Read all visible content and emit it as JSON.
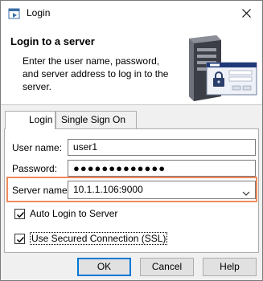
{
  "window": {
    "title": "Login"
  },
  "header": {
    "title": "Login to a server",
    "description": "Enter the user name, password, and server address to log in to the server."
  },
  "tabs": [
    {
      "label": "Login",
      "active": true
    },
    {
      "label": "Single Sign On",
      "active": false
    }
  ],
  "form": {
    "username_label": "User name:",
    "username_value": "user1",
    "password_label": "Password:",
    "password_value": "●●●●●●●●●●●●●",
    "server_label": "Server name:",
    "server_value": "10.1.1.106:9000"
  },
  "options": {
    "auto_login_label": "Auto Login to Server",
    "auto_login_checked": true,
    "ssl_label": "Use Secured Connection (SSL)",
    "ssl_checked": true
  },
  "buttons": {
    "ok": "OK",
    "cancel": "Cancel",
    "help": "Help"
  },
  "colors": {
    "highlight": "#ef8a5e",
    "accent": "#0078d7"
  }
}
